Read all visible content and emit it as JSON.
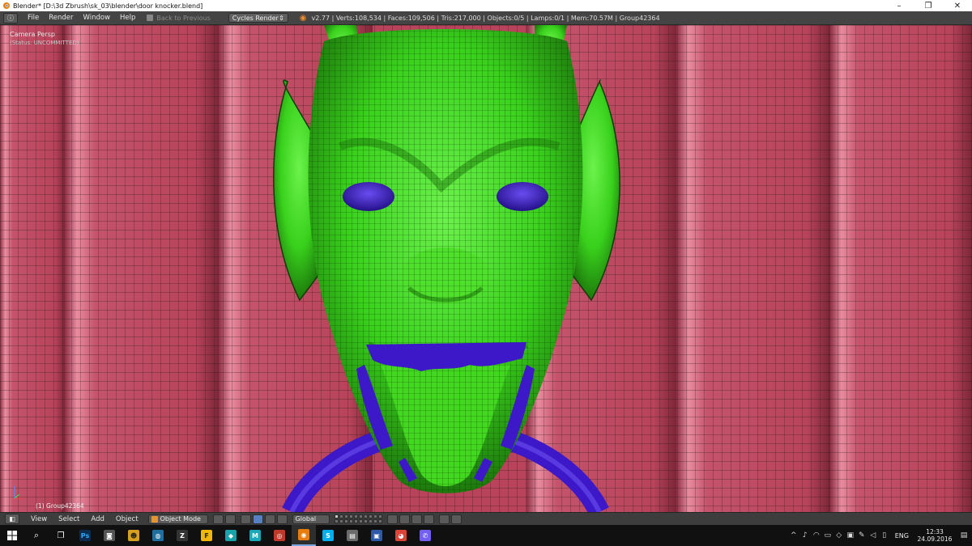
{
  "window": {
    "title": "Blender* [D:\\3d Zbrush\\sk_03\\blender\\door knocker.blend]",
    "minimize_glyph": "–",
    "maximize_glyph": "❐",
    "close_glyph": "✕"
  },
  "infobar": {
    "editor_glyph": "ⓘ",
    "menus": [
      "File",
      "Render",
      "Window",
      "Help"
    ],
    "back_label": "Back to Previous",
    "engine": "Cycles Render",
    "stats": "v2.77 | Verts:108,534 | Faces:109,506 | Tris:217,000 | Objects:0/5 | Lamps:0/1 | Mem:70.57M | Group42364"
  },
  "viewport": {
    "camera_label": "Camera Persp",
    "status_label": "(Status: UNCOMMITTED)",
    "object_label": "(1) Group42364",
    "colors": {
      "door": "#b8435a",
      "door_highlight": "#e98ca0",
      "head": "#39d11c",
      "head_shadow": "#1d7a0c",
      "accent": "#3c18c8",
      "wire": "#1a1a1a"
    }
  },
  "viewheader": {
    "menus": [
      "View",
      "Select",
      "Add",
      "Object"
    ],
    "mode": "Object Mode",
    "orientation": "Global"
  },
  "taskbar": {
    "apps": [
      {
        "icon": "photoshop-icon",
        "letter": "Ps",
        "color": "#0f2a4f",
        "fg": "#31a8ff"
      },
      {
        "icon": "screenshot-icon",
        "letter": "◙",
        "color": "#555555",
        "fg": "#ffffff"
      },
      {
        "icon": "face-app-icon",
        "letter": "☻",
        "color": "#d8a020",
        "fg": "#222222"
      },
      {
        "icon": "globe-app-icon",
        "letter": "◍",
        "color": "#1f6f9e",
        "fg": "#ffffff"
      },
      {
        "icon": "zbrush-icon",
        "letter": "Z",
        "color": "#333333",
        "fg": "#ffffff"
      },
      {
        "icon": "font-app-icon",
        "letter": "F",
        "color": "#f2b705",
        "fg": "#222222"
      },
      {
        "icon": "fish-app-icon",
        "letter": "◆",
        "color": "#18a3a8",
        "fg": "#ffffff"
      },
      {
        "icon": "maya-icon",
        "letter": "M",
        "color": "#1aa9b8",
        "fg": "#ffffff"
      },
      {
        "icon": "app-icon",
        "letter": "◎",
        "color": "#c0392b",
        "fg": "#ffffff"
      },
      {
        "icon": "blender-icon",
        "letter": "◉",
        "color": "#e87d0d",
        "fg": "#ffffff"
      },
      {
        "icon": "skype-icon",
        "letter": "S",
        "color": "#00aff0",
        "fg": "#ffffff"
      },
      {
        "icon": "book-icon",
        "letter": "▤",
        "color": "#6b6b6b",
        "fg": "#ffffff"
      },
      {
        "icon": "save-icon",
        "letter": "▣",
        "color": "#2b5aa8",
        "fg": "#ffffff"
      },
      {
        "icon": "chrome-icon",
        "letter": "◕",
        "color": "#db4437",
        "fg": "#ffffff"
      },
      {
        "icon": "viber-icon",
        "letter": "✆",
        "color": "#7360f2",
        "fg": "#ffffff"
      }
    ],
    "language": "ENG",
    "time": "12:33",
    "date": "24.09.2016"
  }
}
